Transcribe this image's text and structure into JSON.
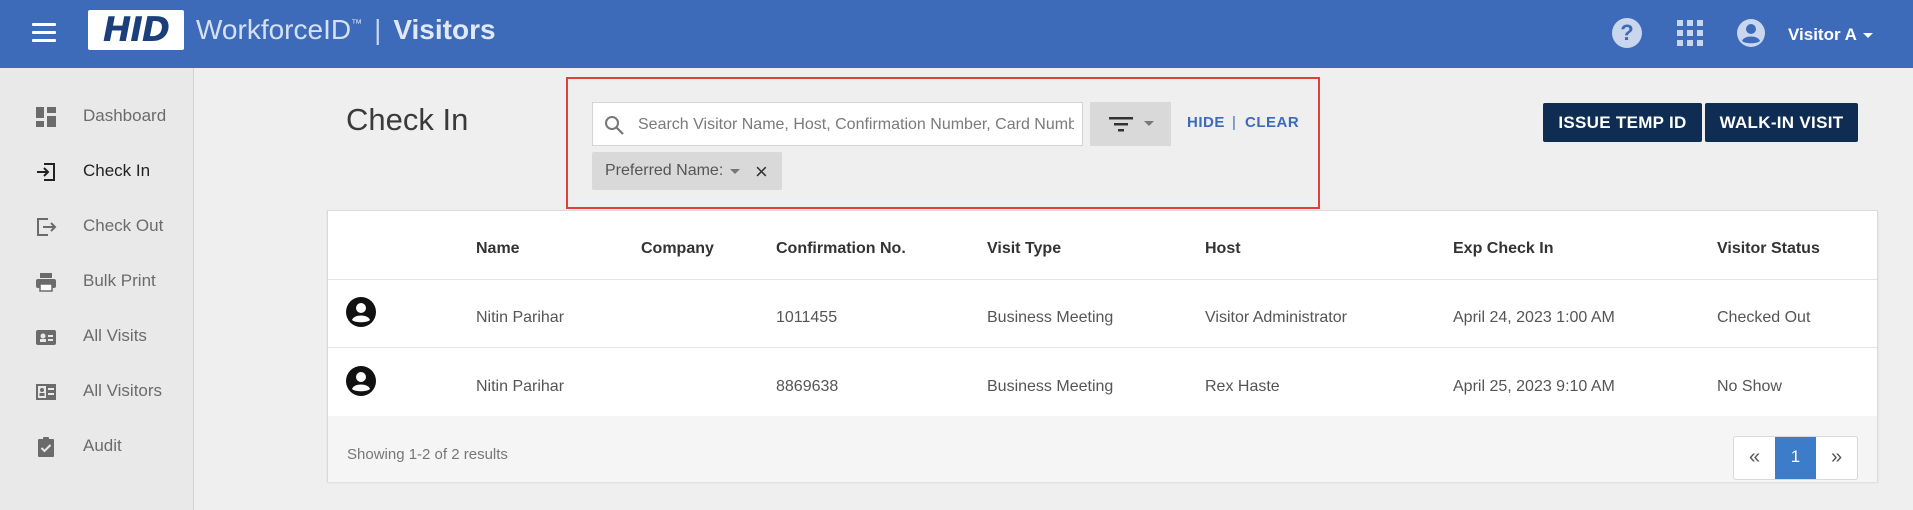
{
  "header": {
    "logo": "HID",
    "product": "WorkforceID",
    "tm": "™",
    "separator": "|",
    "module": "Visitors",
    "user_name": "Visitor A",
    "icons": [
      "menu-icon",
      "help-icon",
      "apps-grid-icon",
      "user-account-icon"
    ]
  },
  "sidebar": {
    "items": [
      {
        "label": "Dashboard",
        "icon": "dashboard-icon"
      },
      {
        "label": "Check In",
        "icon": "check-in-icon",
        "active": true
      },
      {
        "label": "Check Out",
        "icon": "check-out-icon"
      },
      {
        "label": "Bulk Print",
        "icon": "printer-icon"
      },
      {
        "label": "All Visits",
        "icon": "id-card-icon"
      },
      {
        "label": "All Visitors",
        "icon": "visitors-icon"
      },
      {
        "label": "Audit",
        "icon": "clipboard-check-icon"
      }
    ]
  },
  "main": {
    "title": "Check In",
    "search": {
      "placeholder": "Search Visitor Name, Host, Confirmation Number, Card Number",
      "value": ""
    },
    "hide_label": "HIDE",
    "link_separator": "|",
    "clear_label": "CLEAR",
    "filter_chip": {
      "label": "Preferred Name:",
      "remove": "×"
    },
    "buttons": {
      "issue_temp_id": "ISSUE TEMP ID",
      "walk_in_visit": "WALK-IN VISIT"
    }
  },
  "table": {
    "columns": [
      "Name",
      "Company",
      "Confirmation No.",
      "Visit Type",
      "Host",
      "Exp Check In",
      "Visitor Status"
    ],
    "rows": [
      {
        "name": "Nitin Parihar",
        "company": "",
        "confirmation": "1011455",
        "visit_type": "Business Meeting",
        "host": "Visitor Administrator",
        "exp_check_in": "April 24, 2023 1:00 AM",
        "status": "Checked Out"
      },
      {
        "name": "Nitin Parihar",
        "company": "",
        "confirmation": "8869638",
        "visit_type": "Business Meeting",
        "host": "Rex Haste",
        "exp_check_in": "April 25, 2023 9:10 AM",
        "status": "No Show"
      }
    ],
    "results_text": "Showing 1-2 of 2 results",
    "pager": {
      "prev": "«",
      "current": "1",
      "next": "»"
    }
  },
  "colors": {
    "header_bg": "#3d6bba",
    "primary_button": "#0f2d52",
    "highlight_border": "#e0403a",
    "link": "#3d6bba",
    "page_active": "#3d7cc9"
  }
}
